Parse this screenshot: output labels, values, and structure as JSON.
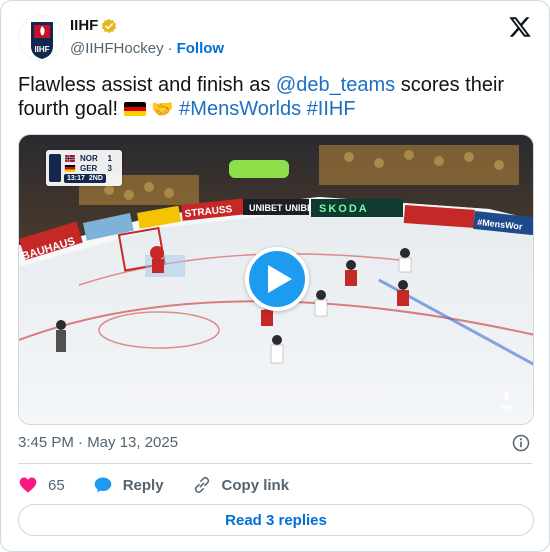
{
  "header": {
    "display_name": "IIHF",
    "handle": "@IIHFHockey",
    "separator": "·",
    "follow_label": "Follow",
    "avatar_text": "IIHF"
  },
  "tweet": {
    "text_parts": {
      "p1": "Flawless assist and finish as ",
      "mention": "@deb_teams",
      "p2": " scores their fourth goal! ",
      "hashtag1": "#MensWorlds",
      "hashtag2": "#IIHF"
    },
    "emoji": [
      "germany-flag",
      "handshake"
    ]
  },
  "media": {
    "type": "video",
    "scoreboard": {
      "home_team": "NOR",
      "home_score": "1",
      "away_team": "GER",
      "away_score": "3",
      "clock": "13:17",
      "period": "2ND"
    },
    "boards": [
      "BAUHAUS",
      "STRAUSS",
      "UNIBET",
      "SKODA",
      "#MensWorlds"
    ],
    "watermark": "IIHF"
  },
  "meta": {
    "timestamp": "3:45 PM · May 13, 2025"
  },
  "actions": {
    "like_count": "65",
    "reply_label": "Reply",
    "copy_label": "Copy link"
  },
  "footer": {
    "read_replies_label": "Read 3 replies"
  },
  "colors": {
    "accent": "#1d9bf0",
    "link": "#006fd6",
    "heart": "#f91880",
    "text": "#0f1419",
    "muted": "#536471"
  }
}
